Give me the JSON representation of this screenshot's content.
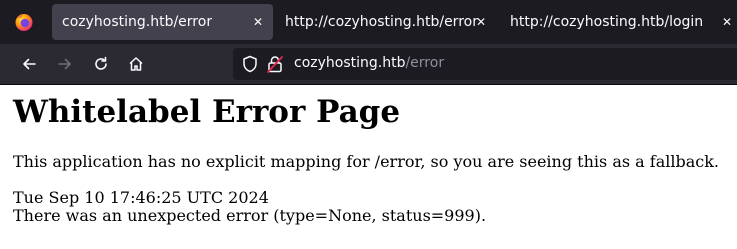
{
  "browser": {
    "tabs": [
      {
        "title": "cozyhosting.htb/error",
        "active": true
      },
      {
        "title": "http://cozyhosting.htb/error",
        "active": false
      },
      {
        "title": "http://cozyhosting.htb/login",
        "active": false
      }
    ],
    "close_glyph": "✕",
    "url_host": "cozyhosting.htb",
    "url_path": "/error"
  },
  "page": {
    "heading": "Whitelabel Error Page",
    "message": "This application has no explicit mapping for /error, so you are seeing this as a fallback.",
    "timestamp": "Tue Sep 10 17:46:25 UTC 2024",
    "error_detail": "There was an unexpected error (type=None, status=999)."
  },
  "icons": [
    "firefox-icon",
    "back-icon",
    "forward-icon",
    "reload-icon",
    "home-icon",
    "shield-icon",
    "insecure-lock-icon",
    "close-icon"
  ],
  "colors": {
    "toolbar": "#2b2a33",
    "tabbar": "#1c1b22",
    "active_tab": "#42414d",
    "url_path": "#8f8f9d"
  }
}
